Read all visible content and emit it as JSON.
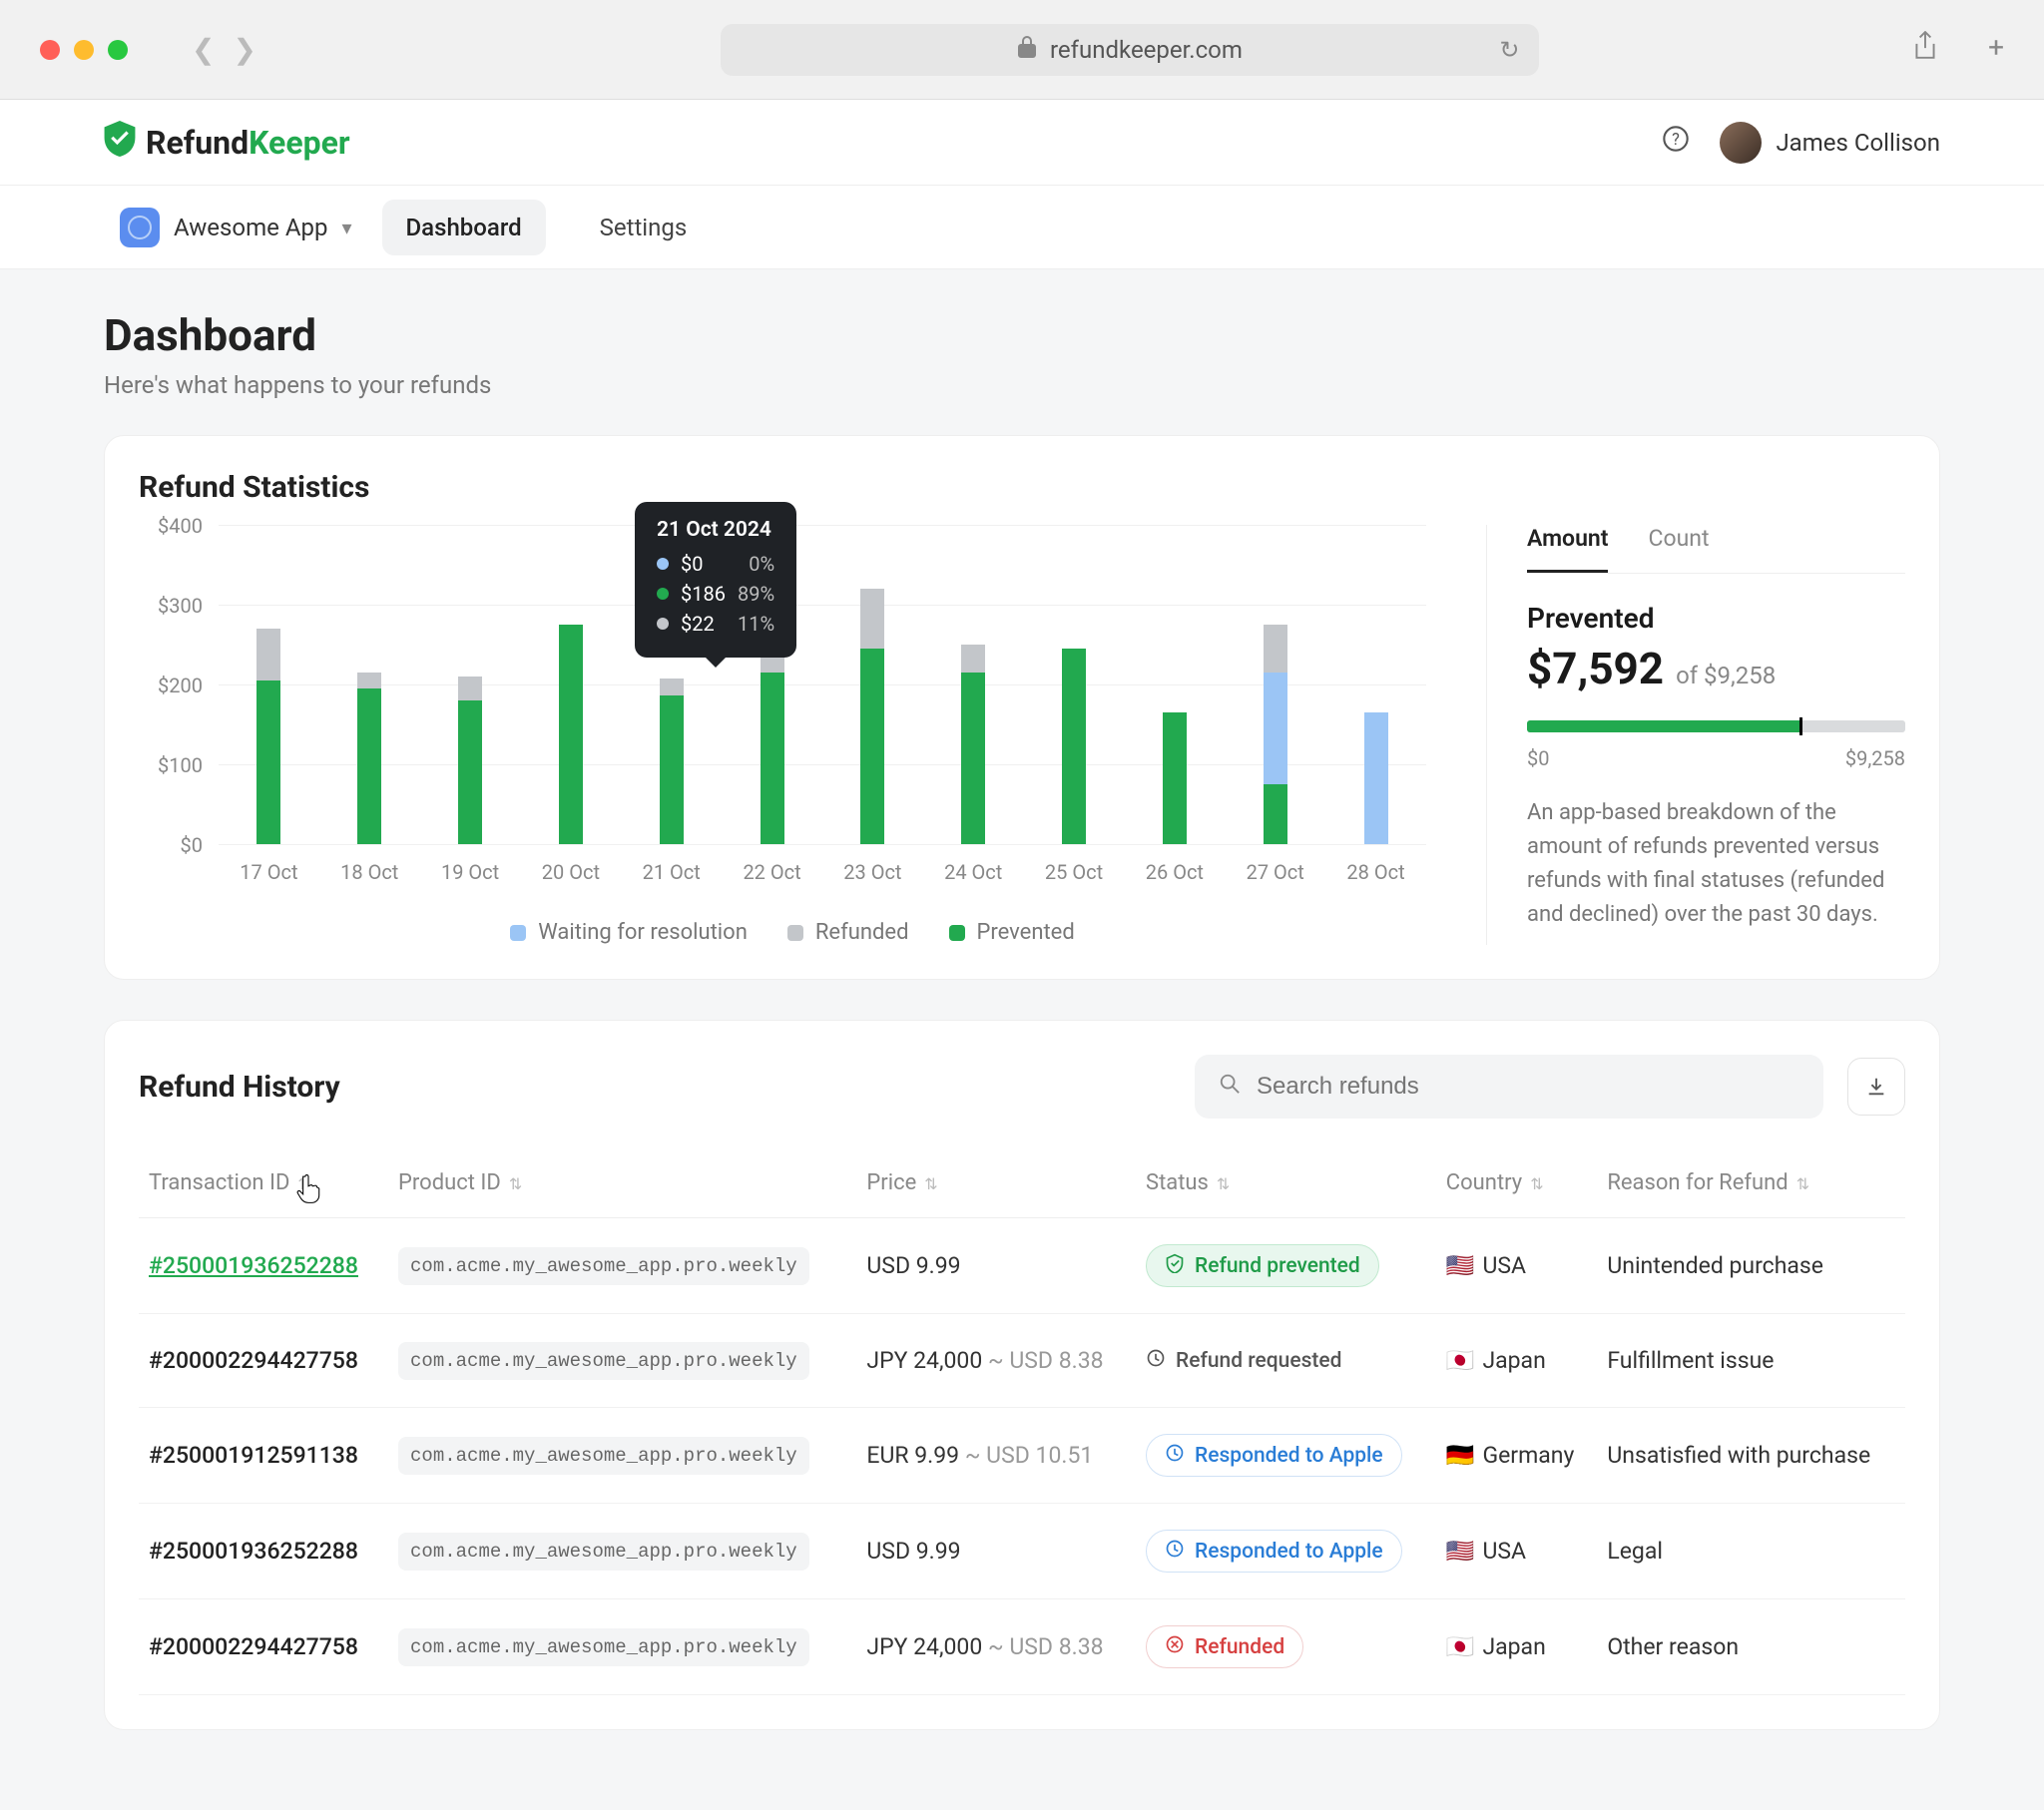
{
  "browser": {
    "url": "refundkeeper.com"
  },
  "header": {
    "brand_prefix": "Refund",
    "brand_suffix": "Keeper",
    "user_name": "James Collison"
  },
  "nav": {
    "app_name": "Awesome App",
    "dashboard": "Dashboard",
    "settings": "Settings"
  },
  "page": {
    "title": "Dashboard",
    "subtitle": "Here's what happens to your refunds"
  },
  "stats": {
    "title": "Refund Statistics",
    "y_ticks": [
      "$0",
      "$100",
      "$200",
      "$300",
      "$400"
    ],
    "legend": {
      "waiting": "Waiting for resolution",
      "refunded": "Refunded",
      "prevented": "Prevented"
    },
    "tooltip": {
      "date": "21 Oct 2024",
      "rows": [
        {
          "color": "#9bc5f5",
          "value": "$0",
          "pct": "0%"
        },
        {
          "color": "#22a94f",
          "value": "$186",
          "pct": "89%"
        },
        {
          "color": "#c3c6ca",
          "value": "$22",
          "pct": "11%"
        }
      ]
    },
    "panel": {
      "tab_amount": "Amount",
      "tab_count": "Count",
      "prevented_label": "Prevented",
      "amount": "$7,592",
      "of_label": "of $9,258",
      "range_min": "$0",
      "range_max": "$9,258",
      "description": "An app-based breakdown of the amount of refunds prevented versus refunds with final statuses (refunded and declined) over the past 30 days."
    }
  },
  "chart_data": {
    "type": "bar",
    "stacked": true,
    "categories": [
      "17 Oct",
      "18 Oct",
      "19 Oct",
      "20 Oct",
      "21 Oct",
      "22 Oct",
      "23 Oct",
      "24 Oct",
      "25 Oct",
      "26 Oct",
      "27 Oct",
      "28 Oct"
    ],
    "ylabel": "USD",
    "ylim": [
      0,
      400
    ],
    "series": [
      {
        "name": "Waiting for resolution",
        "color": "#9bc5f5",
        "values": [
          0,
          0,
          0,
          0,
          0,
          0,
          0,
          0,
          0,
          0,
          140,
          165
        ]
      },
      {
        "name": "Refunded",
        "color": "#c3c6ca",
        "values": [
          65,
          20,
          30,
          0,
          22,
          40,
          75,
          35,
          0,
          0,
          60,
          0
        ]
      },
      {
        "name": "Prevented",
        "color": "#22a94f",
        "values": [
          205,
          195,
          180,
          275,
          186,
          215,
          245,
          215,
          245,
          165,
          75,
          0
        ]
      }
    ]
  },
  "history": {
    "title": "Refund History",
    "search_placeholder": "Search refunds",
    "columns": {
      "txn": "Transaction ID",
      "product": "Product ID",
      "price": "Price",
      "status": "Status",
      "country": "Country",
      "reason": "Reason for Refund"
    },
    "status_labels": {
      "prevented": "Refund prevented",
      "requested": "Refund requested",
      "responded": "Responded to Apple",
      "refunded": "Refunded"
    },
    "rows": [
      {
        "txn": "#250001936252288",
        "link": true,
        "product": "com.acme.my_awesome_app.pro.weekly",
        "price": "USD 9.99",
        "price_alt": "",
        "status": "prevented",
        "flag": "🇺🇸",
        "country": "USA",
        "reason": "Unintended purchase"
      },
      {
        "txn": "#200002294427758",
        "link": false,
        "product": "com.acme.my_awesome_app.pro.weekly",
        "price": "JPY 24,000",
        "price_alt": "~ USD 8.38",
        "status": "requested",
        "flag": "🇯🇵",
        "country": "Japan",
        "reason": "Fulfillment issue"
      },
      {
        "txn": "#250001912591138",
        "link": false,
        "product": "com.acme.my_awesome_app.pro.weekly",
        "price": "EUR 9.99",
        "price_alt": "~ USD 10.51",
        "status": "responded",
        "flag": "🇩🇪",
        "country": "Germany",
        "reason": "Unsatisfied with purchase"
      },
      {
        "txn": "#250001936252288",
        "link": false,
        "product": "com.acme.my_awesome_app.pro.weekly",
        "price": "USD 9.99",
        "price_alt": "",
        "status": "responded",
        "flag": "🇺🇸",
        "country": "USA",
        "reason": "Legal"
      },
      {
        "txn": "#200002294427758",
        "link": false,
        "product": "com.acme.my_awesome_app.pro.weekly",
        "price": "JPY 24,000",
        "price_alt": "~ USD 8.38",
        "status": "refunded",
        "flag": "🇯🇵",
        "country": "Japan",
        "reason": "Other reason"
      }
    ]
  }
}
